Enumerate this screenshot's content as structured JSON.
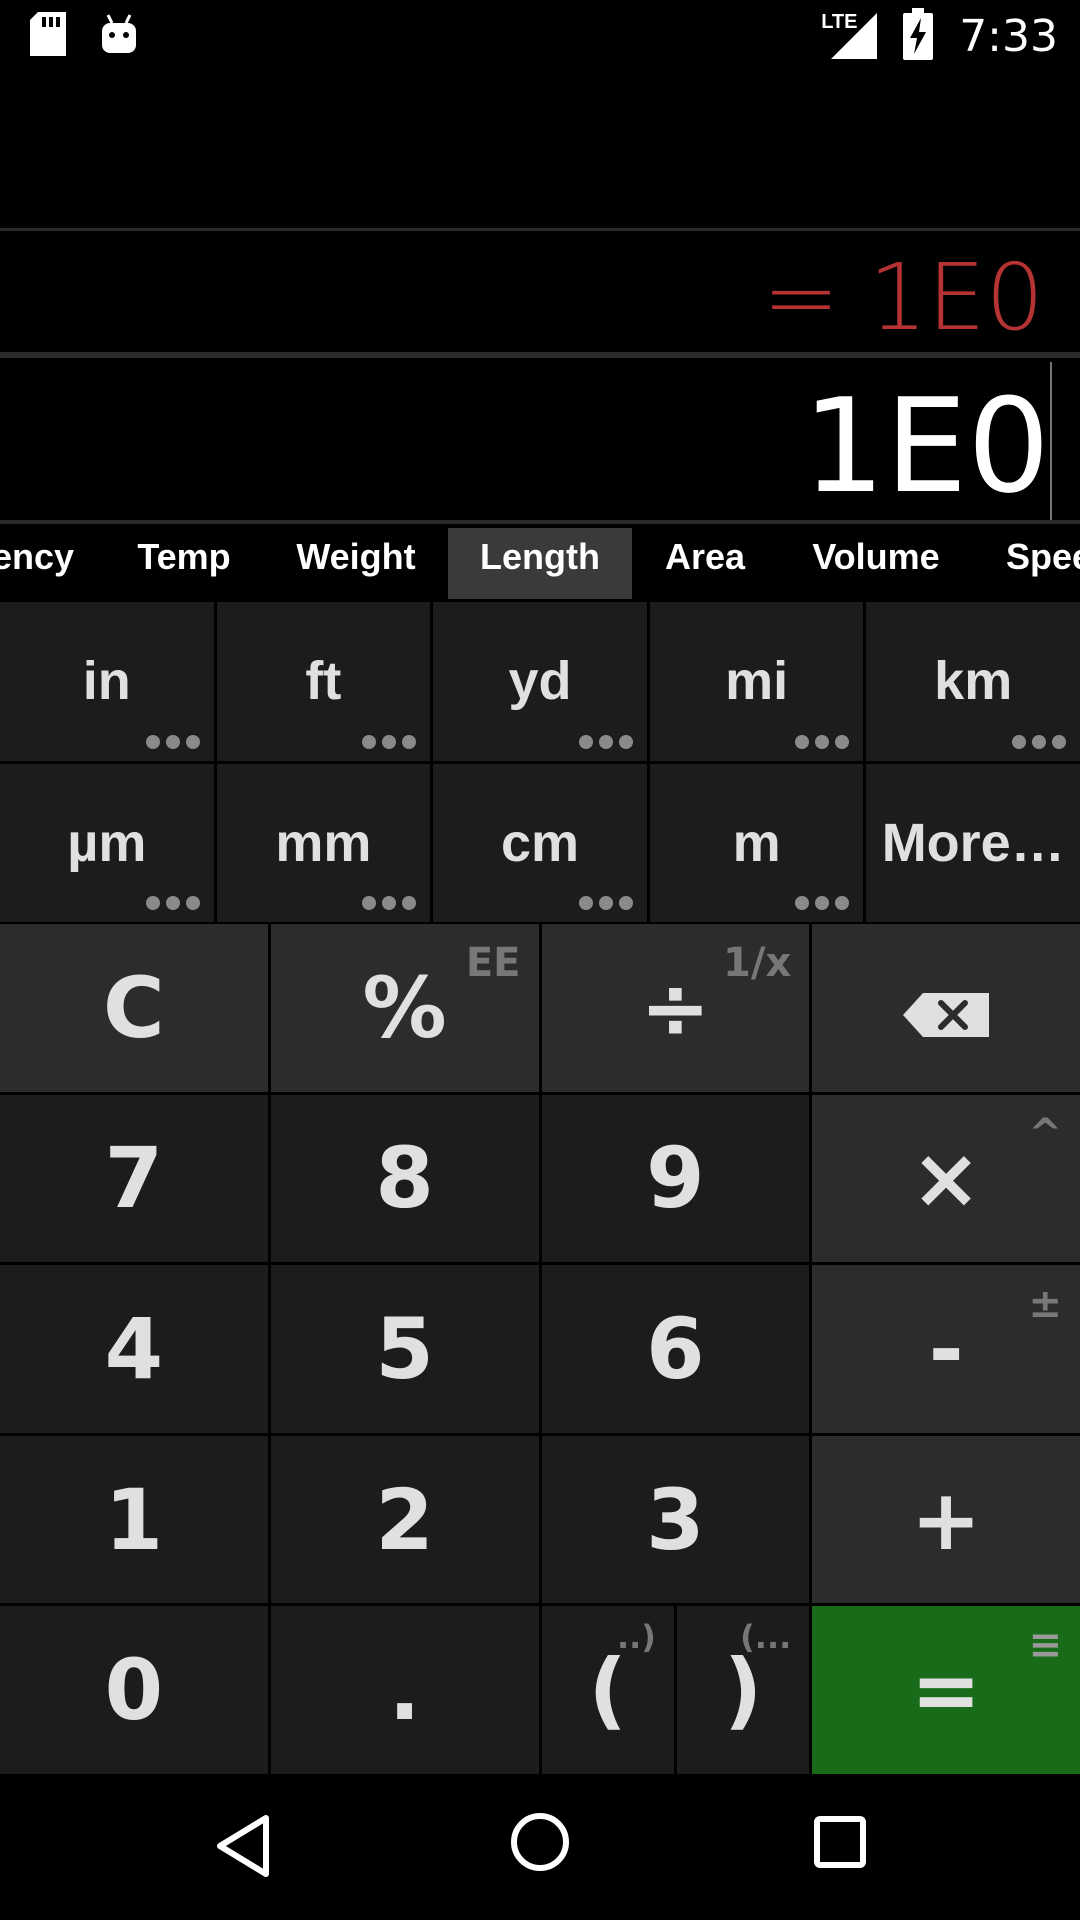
{
  "status": {
    "time": "7:33",
    "network": "LTE",
    "icons": [
      "sd-card-icon",
      "android-icon",
      "signal-icon",
      "battery-charging-icon"
    ]
  },
  "display": {
    "result": "= 1E0",
    "input": "1E0"
  },
  "tabs": [
    "ency",
    "Temp",
    "Weight",
    "Length",
    "Area",
    "Volume",
    "Spee"
  ],
  "active_tab": "Length",
  "units": [
    {
      "label": "in",
      "dots": true
    },
    {
      "label": "ft",
      "dots": true
    },
    {
      "label": "yd",
      "dots": true
    },
    {
      "label": "mi",
      "dots": true
    },
    {
      "label": "km",
      "dots": true
    },
    {
      "label": "µm",
      "dots": true
    },
    {
      "label": "mm",
      "dots": true
    },
    {
      "label": "cm",
      "dots": true
    },
    {
      "label": "m",
      "dots": true
    },
    {
      "label": "More…",
      "dots": false
    }
  ],
  "keys": {
    "clear": "C",
    "percent": "%",
    "percent_sub": "EE",
    "divide": "÷",
    "divide_sub": "1/x",
    "seven": "7",
    "eight": "8",
    "nine": "9",
    "multiply": "×",
    "multiply_sub": "^",
    "four": "4",
    "five": "5",
    "six": "6",
    "minus": "-",
    "minus_sub": "±",
    "one": "1",
    "two": "2",
    "three": "3",
    "plus": "+",
    "zero": "0",
    "dot": ".",
    "open_paren": "(",
    "open_paren_sub": "..)",
    "close_paren": ")",
    "close_paren_sub": "(...",
    "equals": "=",
    "equals_sub": "≡"
  },
  "colors": {
    "result": "#b63333",
    "equals_key": "#186b18",
    "key_bg": "#1c1c1c",
    "op_key_bg": "#2c2c2c"
  }
}
